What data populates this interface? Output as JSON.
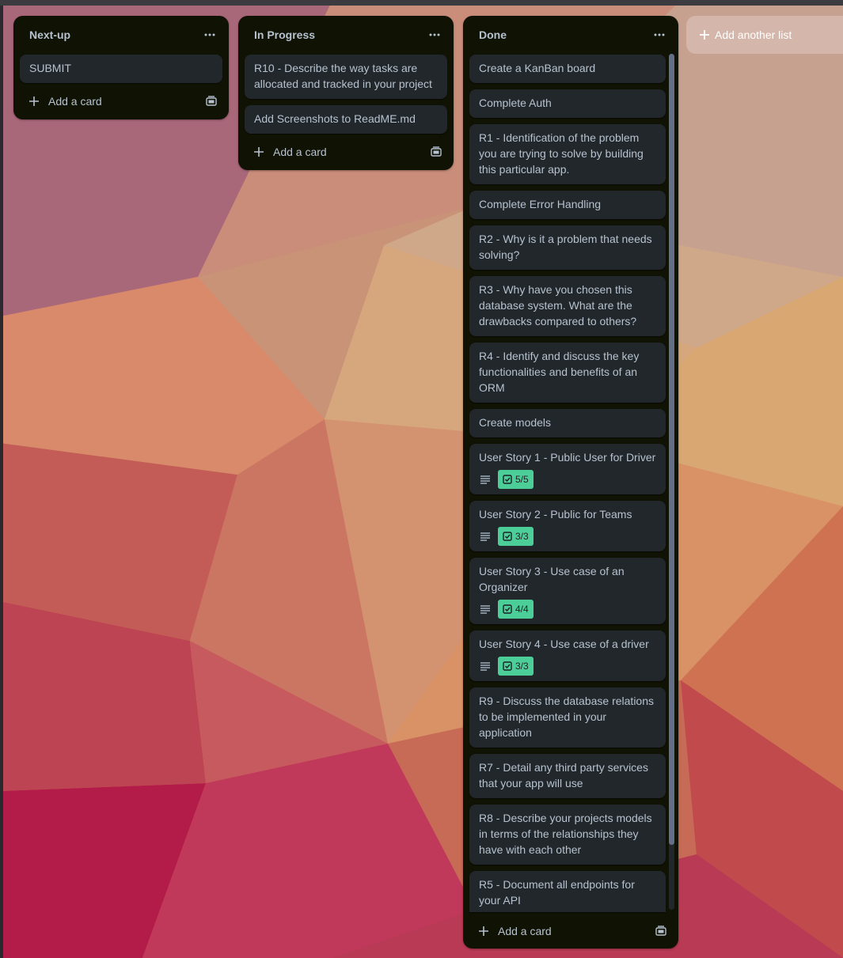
{
  "board": {
    "add_list_label": "Add another list",
    "lists": [
      {
        "title": "Next-up",
        "cards": [
          {
            "text": "SUBMIT"
          }
        ],
        "add_card_label": "Add a card"
      },
      {
        "title": "In Progress",
        "cards": [
          {
            "text": "R10 - Describe the way tasks are allocated and tracked in your project"
          },
          {
            "text": "Add Screenshots to ReadME.md"
          }
        ],
        "add_card_label": "Add a card"
      },
      {
        "title": "Done",
        "cards": [
          {
            "text": "Create a KanBan board"
          },
          {
            "text": "Complete Auth"
          },
          {
            "text": "R1 - Identification of the problem you are trying to solve by building this particular app."
          },
          {
            "text": "Complete Error Handling"
          },
          {
            "text": "R2 - Why is it a problem that needs solving?"
          },
          {
            "text": "R3 - Why have you chosen this database system. What are the drawbacks compared to others?"
          },
          {
            "text": "R4 - Identify and discuss the key functionalities and benefits of an ORM"
          },
          {
            "text": "Create models"
          },
          {
            "text": "User Story 1 - Public User for Driver",
            "checklist": "5/5"
          },
          {
            "text": "User Story 2 - Public for Teams",
            "checklist": "3/3"
          },
          {
            "text": "User Story 3 - Use case of an Organizer",
            "checklist": "4/4"
          },
          {
            "text": "User Story 4 - Use case of a driver",
            "checklist": "3/3"
          },
          {
            "text": "R9 - Discuss the database relations to be implemented in your application"
          },
          {
            "text": "R7 - Detail any third party services that your app will use"
          },
          {
            "text": "R8 - Describe your projects models in terms of the relationships they have with each other"
          },
          {
            "text": "R5 - Document all endpoints for your API"
          }
        ],
        "add_card_label": "Add a card"
      }
    ]
  },
  "colors": {
    "list_bg": "#101204",
    "card_bg": "#22272b",
    "card_text": "#b6c2cf",
    "checklist_complete": "#4bce97"
  },
  "icons": {
    "list_menu": "ellipsis-icon",
    "add_card": "plus-icon",
    "card_template": "template-icon",
    "description": "description-icon",
    "checklist": "checkbox-icon"
  }
}
